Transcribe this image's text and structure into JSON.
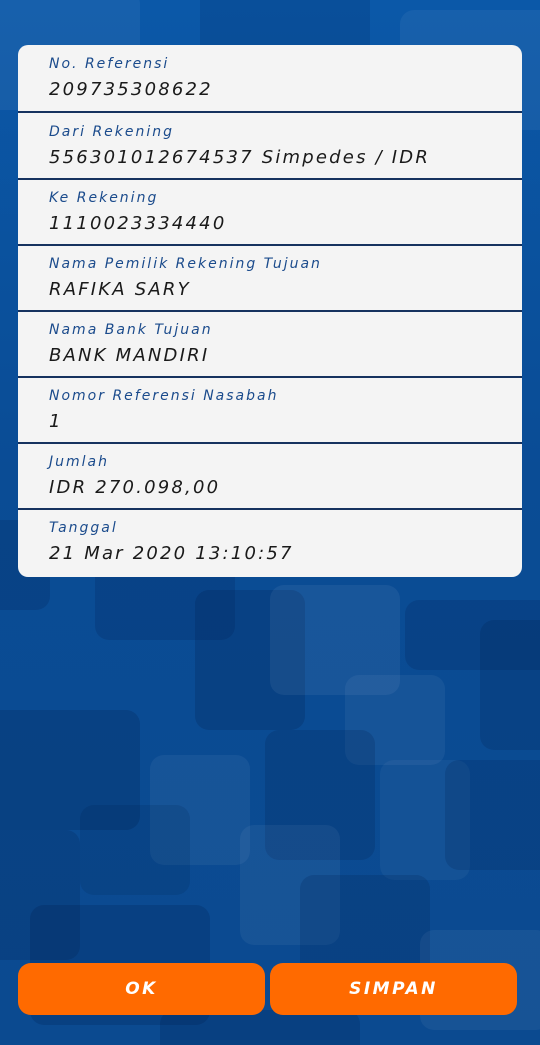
{
  "details": [
    {
      "label": "No. Referensi",
      "value": "209735308622"
    },
    {
      "label": "Dari Rekening",
      "value": "556301012674537 Simpedes / IDR"
    },
    {
      "label": "Ke Rekening",
      "value": "1110023334440"
    },
    {
      "label": "Nama Pemilik Rekening Tujuan",
      "value": "RAFIKA SARY"
    },
    {
      "label": "Nama Bank Tujuan",
      "value": "BANK MANDIRI"
    },
    {
      "label": "Nomor Referensi Nasabah",
      "value": "1"
    },
    {
      "label": "Jumlah",
      "value": "IDR 270.098,00"
    },
    {
      "label": "Tanggal",
      "value": "21 Mar 2020 13:10:57"
    }
  ],
  "buttons": {
    "ok_label": "OK",
    "save_label": "SIMPAN"
  },
  "colors": {
    "background": "#0a4d98",
    "card": "#f4f4f4",
    "label_text": "#1b4b8c",
    "value_text": "#1a1a1a",
    "divider": "#16325f",
    "button": "#ff6a00",
    "button_text": "#ffffff"
  }
}
